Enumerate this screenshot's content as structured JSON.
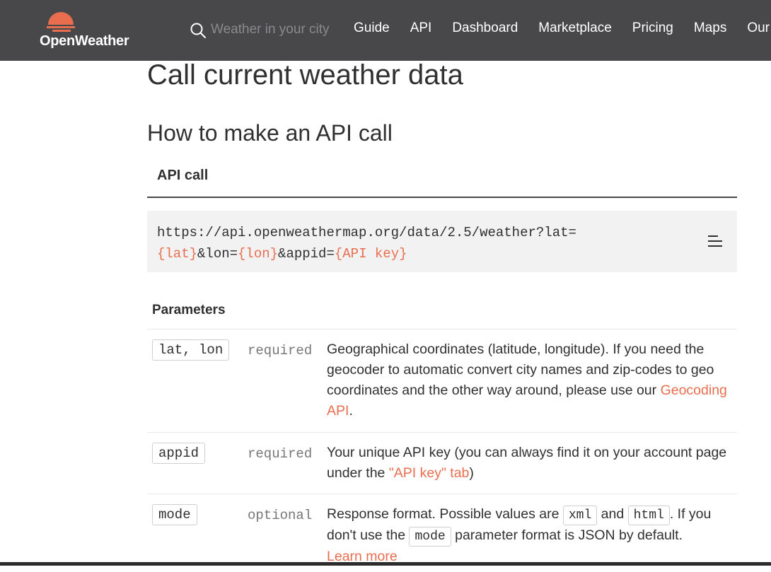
{
  "header": {
    "brand": "OpenWeather",
    "search_placeholder": "Weather in your city",
    "nav": [
      "Guide",
      "API",
      "Dashboard",
      "Marketplace",
      "Pricing",
      "Maps",
      "Our"
    ]
  },
  "page": {
    "title": "Call current weather data",
    "section": "How to make an API call",
    "tab": "API call",
    "code": {
      "line1": "https://api.openweathermap.org/data/2.5/weather?lat=",
      "lat": "{lat}",
      "amp_lon": "&lon=",
      "lon": "{lon}",
      "amp_appid": "&appid=",
      "key": "{API key}"
    },
    "params_title": "Parameters",
    "params": [
      {
        "name": "lat, lon",
        "req": "required",
        "desc": "Geographical coordinates (latitude, longitude). If you need the geocoder to automatic convert city names and zip-codes to geo coordinates and the other way around, please use our ",
        "link": "Geocoding API",
        "after": "."
      },
      {
        "name": "appid",
        "req": "required",
        "desc": "Your unique API key (you can always find it on your account page under the ",
        "link": "\"API key\" tab",
        "after": ")"
      },
      {
        "name": "mode",
        "req": "optional",
        "desc_a": "Response format. Possible values are ",
        "code_a": "xml",
        "desc_b": " and ",
        "code_b": "html",
        "desc_c": ". If you don't use the ",
        "code_c": "mode",
        "desc_d": " parameter format is JSON by default.",
        "link": "Learn more"
      }
    ]
  },
  "colors": {
    "header_bg": "#48484a",
    "accent": "#e96e50",
    "code_bg": "#f2f2f2"
  }
}
